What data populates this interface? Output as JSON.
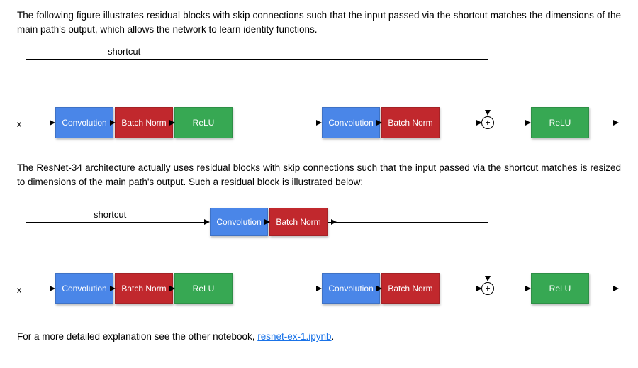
{
  "text": {
    "p1": "The following figure illustrates residual blocks with skip connections such that the input passed via the shortcut matches the dimensions of the main path's output, which allows the network to learn identity functions.",
    "p2": "The ResNet-34 architecture actually uses residual blocks with skip connections such that the input passed via the shortcut matches is resized to dimensions of the main path's output. Such a residual block is illustrated below:",
    "p3_prefix": "For a more detailed explanation see the other notebook, ",
    "p3_link": "resnet-ex-1.ipynb",
    "p3_suffix": "."
  },
  "labels": {
    "shortcut": "shortcut",
    "x": "x",
    "conv": "Convolution",
    "bn": "Batch Norm",
    "relu": "ReLU",
    "plus": "+"
  },
  "colors": {
    "conv": "#4a86e8",
    "bn": "#c1282d",
    "relu": "#37a853"
  },
  "diagram1": {
    "type": "residual-block-identity",
    "shortcut_path": [
      "identity"
    ],
    "main_path": [
      "Convolution",
      "Batch Norm",
      "ReLU",
      "Convolution",
      "Batch Norm"
    ],
    "merge": "add",
    "post_merge": [
      "ReLU"
    ]
  },
  "diagram2": {
    "type": "residual-block-projection",
    "shortcut_path": [
      "Convolution",
      "Batch Norm"
    ],
    "main_path": [
      "Convolution",
      "Batch Norm",
      "ReLU",
      "Convolution",
      "Batch Norm"
    ],
    "merge": "add",
    "post_merge": [
      "ReLU"
    ]
  }
}
